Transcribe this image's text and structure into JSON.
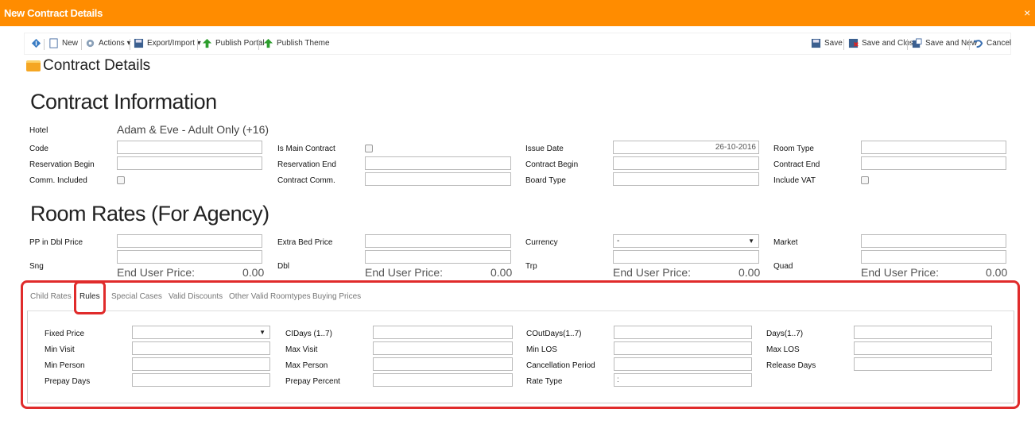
{
  "window": {
    "title": "New Contract Details",
    "close": "×"
  },
  "toolbar": {
    "left": [
      {
        "label": "",
        "icon": "info-icon"
      },
      {
        "label": "New",
        "icon": "new-document-icon"
      },
      {
        "label": "Actions ▾",
        "icon": "gear-icon"
      },
      {
        "label": "Export/Import ▾",
        "icon": "save-disk-icon"
      },
      {
        "label": "Publish Portal",
        "icon": "up-arrow-icon"
      },
      {
        "label": "Publish Theme",
        "icon": "up-arrow-icon"
      }
    ],
    "right": [
      {
        "label": "Save",
        "icon": "save-disk-icon"
      },
      {
        "label": "Save and Close",
        "icon": "save-close-icon"
      },
      {
        "label": "Save and New",
        "icon": "save-new-icon"
      },
      {
        "label": "Cancel",
        "icon": "undo-icon"
      }
    ]
  },
  "section": {
    "title": "Contract Details"
  },
  "contract": {
    "heading": "Contract Information",
    "hotel_label": "Hotel",
    "hotel_value": "Adam & Eve - Adult Only (+16)",
    "code": "Code",
    "is_main": "Is Main Contract",
    "issue_date": "Issue Date",
    "issue_date_value": "26-10-2016",
    "room_type": "Room Type",
    "res_begin": "Reservation Begin",
    "res_end": "Reservation End",
    "contract_begin": "Contract Begin",
    "contract_end": "Contract End",
    "comm_included": "Comm. Included",
    "contract_comm": "Contract Comm.",
    "board_type": "Board Type",
    "include_vat": "Include VAT"
  },
  "rates": {
    "heading": "Room Rates (For Agency)",
    "pp_dbl": "PP in Dbl Price",
    "extra_bed": "Extra Bed Price",
    "currency": "Currency",
    "currency_value": "-",
    "market": "Market",
    "sng": "Sng",
    "dbl": "Dbl",
    "trp": "Trp",
    "quad": "Quad",
    "end_user": "End User Price:",
    "end_user_value": "0.00"
  },
  "tabs": [
    "Child Rates",
    "Rules",
    "Special Cases",
    "Valid Discounts",
    "Other Valid Roomtypes",
    "Buying Prices"
  ],
  "rules": {
    "fixed_price": "Fixed Price",
    "cidays": "CIDays (1..7)",
    "coutdays": "COutDays(1..7)",
    "days": "Days(1..7)",
    "min_visit": "Min Visit",
    "max_visit": "Max Visit",
    "min_los": "Min LOS",
    "max_los": "Max LOS",
    "min_person": "Min Person",
    "max_person": "Max Person",
    "cancel_period": "Cancellation Period",
    "release_days": "Release Days",
    "prepay_days": "Prepay Days",
    "prepay_percent": "Prepay Percent",
    "rate_type": "Rate Type",
    "rate_type_value": ":"
  },
  "colors": {
    "accent": "#ff8c00",
    "highlight": "#e02b2b"
  }
}
